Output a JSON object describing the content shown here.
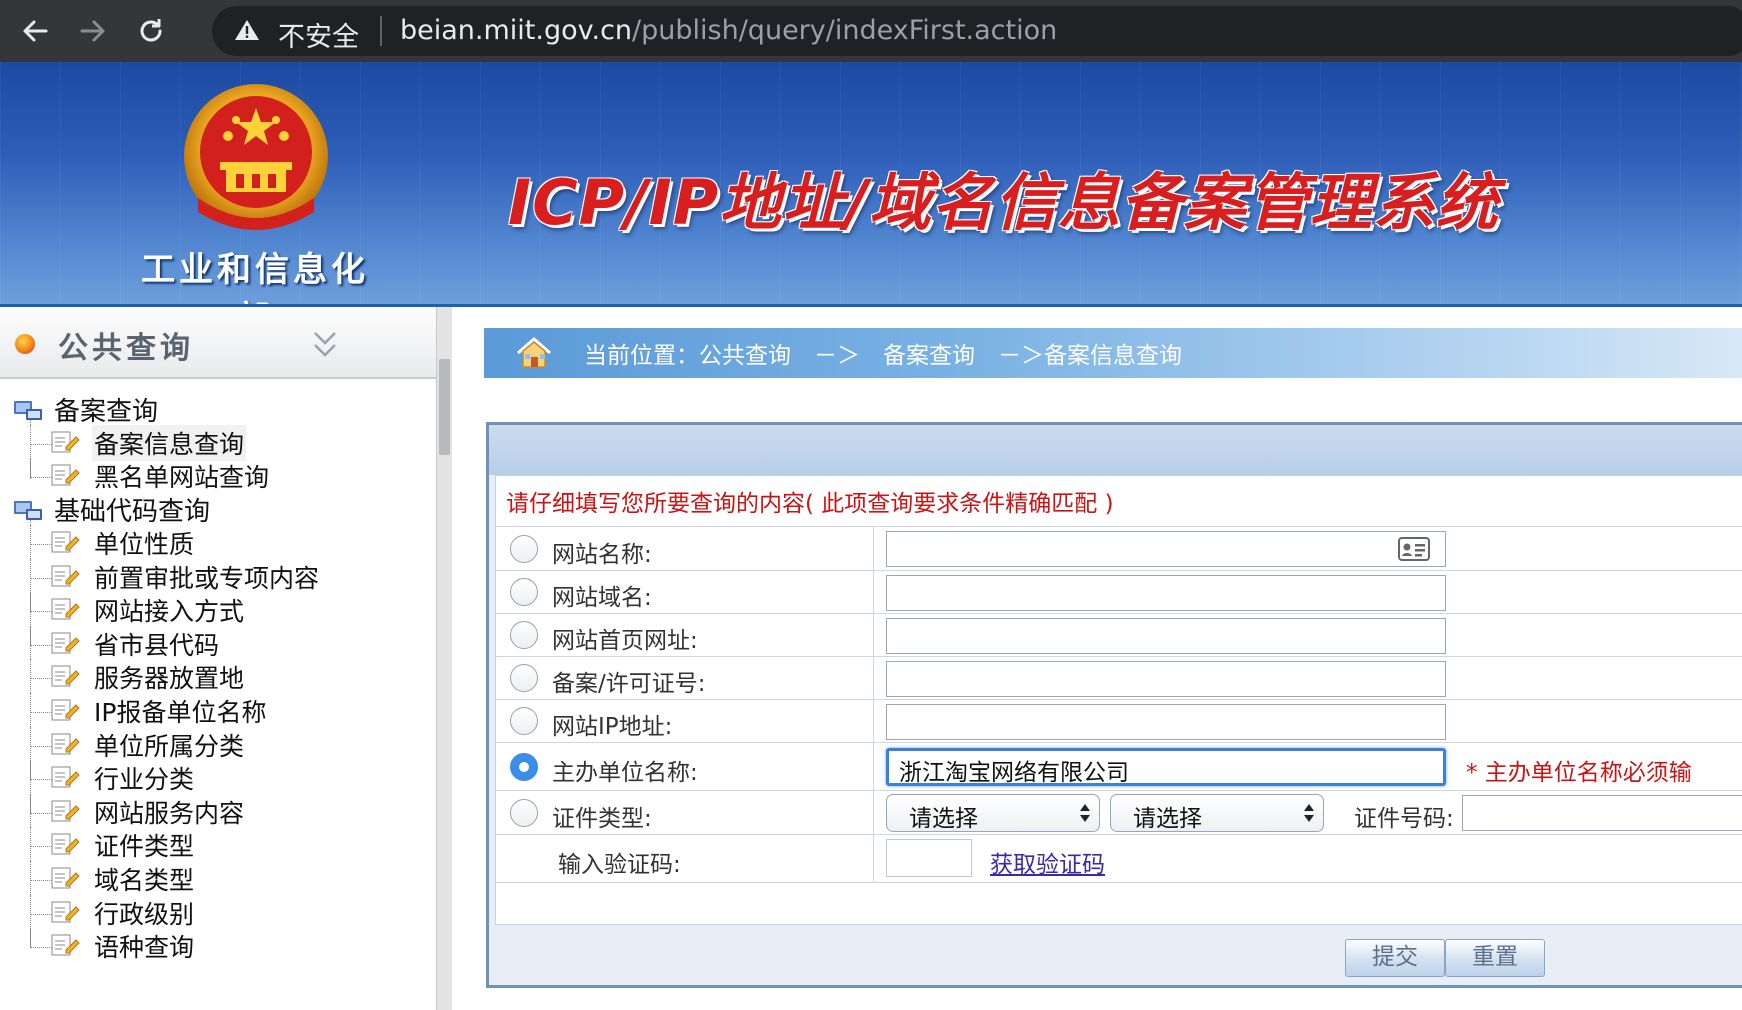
{
  "browser": {
    "security_label": "不安全",
    "url_host": "beian.miit.gov.cn",
    "url_path": "/publish/query/indexFirst.action"
  },
  "header": {
    "ministry": "工业和信息化部",
    "system_title": "ICP/IP地址/域名信息备案管理系统"
  },
  "sidebar": {
    "title": "公共查询",
    "categories": [
      {
        "label": "备案查询",
        "items": [
          "备案信息查询",
          "黑名单网站查询"
        ]
      },
      {
        "label": "基础代码查询",
        "items": [
          "单位性质",
          "前置审批或专项内容",
          "网站接入方式",
          "省市县代码",
          "服务器放置地",
          "IP报备单位名称",
          "单位所属分类",
          "行业分类",
          "网站服务内容",
          "证件类型",
          "域名类型",
          "行政级别",
          "语种查询"
        ]
      }
    ]
  },
  "breadcrumb": {
    "text": "当前位置：公共查询　－＞　备案查询　－＞备案信息查询"
  },
  "form": {
    "notice": "请仔细填写您所要查询的内容( 此项查询要求条件精确匹配 )",
    "fields": [
      {
        "label": "网站名称:",
        "value": ""
      },
      {
        "label": "网站域名:",
        "value": ""
      },
      {
        "label": "网站首页网址:",
        "value": ""
      },
      {
        "label": "备案/许可证号:",
        "value": ""
      },
      {
        "label": "网站IP地址:",
        "value": ""
      },
      {
        "label": "主办单位名称:",
        "value": "浙江淘宝网络有限公司"
      }
    ],
    "required_note": "* 主办单位名称必须输",
    "cert_type_label": "证件类型:",
    "select_1": "请选择",
    "select_2": "请选择",
    "cert_number_label": "证件号码:",
    "captcha_label": "输入验证码:",
    "captcha_link": "获取验证码",
    "submit_label": "提交",
    "reset_label": "重置"
  },
  "colors": {
    "banner": "#2e5db8",
    "title_red": "#d81e1e",
    "notice_red": "#c91414",
    "radio_selected": "#3b8ee8"
  }
}
